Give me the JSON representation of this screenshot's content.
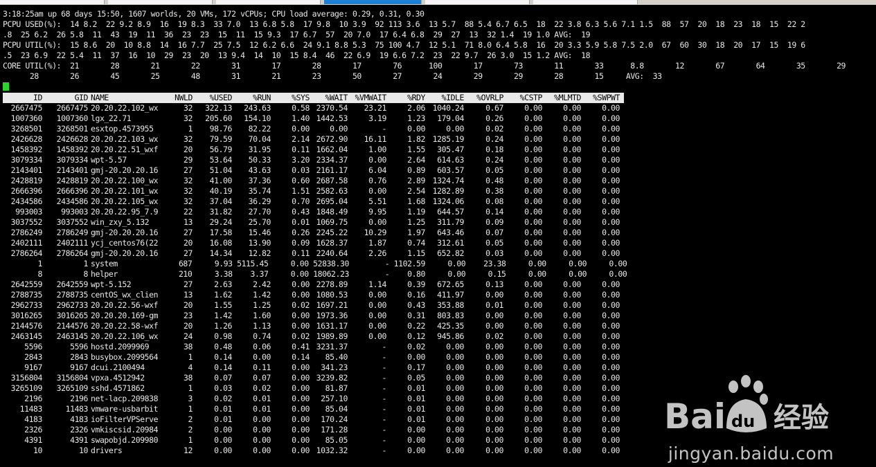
{
  "summary": {
    "l1": "3:18:25am up 68 days 15:50, 1607 worlds, 20 VMs, 172 vCPUs; CPU load average: 0.29, 0.31, 0.30",
    "l2": "PCPU USED(%):  14 8.2  22 9.2 8.9  16  19 8.3  33 7.0  13 6.8 5.8  17 9.8  10 3.9  92 113 3.6  13 5.7  88 5.4 6.7 6.5  18  22 3.8 6.3 5.6 7.1 1.5  88  57  20  18  23  18  15  22 2",
    "l3": ".8  25 6.2  26 5.8  11  43  19  11  36  23  23  15  11  15 9.3  17 6.7  57  20 7.0  17 6.4 6.8  29  27  13  32 1.4  19 1.0 AVG:  19",
    "l4": "PCPU UTIL(%):  15 8.6  20  10 8.8  14  16 7.7  25 7.5  12 6.2 6.6  24 9.1 8.8 5.3  75 100 4.7  12 5.1  71 8.0 6.4 5.8  16  20 3.3 5.9 5.8 7.5 2.0  67  60  30  18  20  17  15  19 6",
    "l5": ".5  23 6.9  22 5.4  11  37  16  10  29  23  20  13 9.4  14  10  15 8.4  46  22 6.9  19 6.6 7.2  23  22 9.7  26 3.0  15 1.2 AVG:  18",
    "l6": "CORE UTIL(%):  21       28       21       22       31       17       28       17       76      100       17       73       11       33      8.8       12       67       64       35       29       24",
    "l7": "      28       26       45       25       48       31       21       23       50       27       24       29       29       28       15     AVG:  33"
  },
  "columns": [
    "ID",
    "GID",
    "NAME",
    "NWLD",
    "%USED",
    "%RUN",
    "%SYS",
    "%WAIT",
    "%VMWAIT",
    "%RDY",
    "%IDLE",
    "%OVRLP",
    "%CSTP",
    "%MLMTD",
    "%SWPWT"
  ],
  "rows": [
    [
      "2667475",
      "2667475",
      "20.20.22.102_wx",
      "32",
      "322.13",
      "243.63",
      "0.58",
      "2370.54",
      "23.21",
      "2.06",
      "1040.24",
      "0.67",
      "0.00",
      "0.00",
      "0.00"
    ],
    [
      "1007360",
      "1007360",
      "lgx_22.71",
      "32",
      "205.60",
      "154.10",
      "1.40",
      "1442.53",
      "3.19",
      "1.23",
      "179.04",
      "0.26",
      "0.00",
      "0.00",
      "0.00"
    ],
    [
      "3268501",
      "3268501",
      "esxtop.4573955",
      "1",
      "98.76",
      "82.22",
      "0.00",
      "0.00",
      "-",
      "0.00",
      "0.00",
      "0.02",
      "0.00",
      "0.00",
      "0.00"
    ],
    [
      "2426628",
      "2426628",
      "20.20.22.103_wx",
      "32",
      "79.59",
      "70.04",
      "2.14",
      "2672.90",
      "16.11",
      "1.82",
      "1285.19",
      "0.24",
      "0.00",
      "0.00",
      "0.00"
    ],
    [
      "1458392",
      "1458392",
      "20.20.22.51_wxf",
      "20",
      "56.79",
      "31.95",
      "0.11",
      "1662.04",
      "1.00",
      "1.55",
      "305.47",
      "0.18",
      "0.00",
      "0.00",
      "0.00"
    ],
    [
      "3079334",
      "3079334",
      "wpt-5.57",
      "29",
      "53.64",
      "50.33",
      "3.20",
      "2334.37",
      "0.00",
      "2.64",
      "614.63",
      "0.24",
      "0.00",
      "0.00",
      "0.00"
    ],
    [
      "2143401",
      "2143401",
      "gmj-20.20.20.16",
      "27",
      "51.04",
      "43.63",
      "0.03",
      "2161.17",
      "6.04",
      "0.89",
      "603.57",
      "0.05",
      "0.00",
      "0.00",
      "0.00"
    ],
    [
      "2428819",
      "2428819",
      "20.20.22.100_wx",
      "32",
      "41.00",
      "37.36",
      "0.60",
      "2687.58",
      "0.76",
      "2.89",
      "1324.74",
      "0.48",
      "0.00",
      "0.00",
      "0.00"
    ],
    [
      "2666396",
      "2666396",
      "20.20.22.101_wx",
      "32",
      "40.19",
      "35.74",
      "1.51",
      "2582.63",
      "0.00",
      "2.54",
      "1282.89",
      "0.38",
      "0.00",
      "0.00",
      "0.00"
    ],
    [
      "2434586",
      "2434586",
      "20.20.22.105_wx",
      "32",
      "37.04",
      "36.29",
      "0.70",
      "2695.04",
      "5.51",
      "1.68",
      "1324.06",
      "0.08",
      "0.00",
      "0.00",
      "0.00"
    ],
    [
      "993003",
      "993003",
      "20.20.22.95_7.9",
      "22",
      "31.82",
      "27.70",
      "0.43",
      "1848.49",
      "9.95",
      "1.19",
      "644.57",
      "0.14",
      "0.00",
      "0.00",
      "0.00"
    ],
    [
      "3037552",
      "3037552",
      "win_zxy_5.132",
      "13",
      "29.24",
      "25.70",
      "0.01",
      "1069.75",
      "0.00",
      "1.25",
      "311.79",
      "0.09",
      "0.00",
      "0.00",
      "0.00"
    ],
    [
      "2786249",
      "2786249",
      "gmj-20.20.20.16",
      "27",
      "17.58",
      "15.46",
      "0.26",
      "2245.22",
      "10.29",
      "1.97",
      "643.46",
      "0.07",
      "0.00",
      "0.00",
      "0.00"
    ],
    [
      "2402111",
      "2402111",
      "ycj_centos76(22",
      "20",
      "16.08",
      "13.90",
      "0.09",
      "1628.37",
      "1.87",
      "0.74",
      "312.61",
      "0.05",
      "0.00",
      "0.00",
      "0.00"
    ],
    [
      "2786264",
      "2786264",
      "gmj-20.20.20.16",
      "27",
      "14.34",
      "12.82",
      "0.11",
      "2240.64",
      "2.26",
      "1.15",
      "652.82",
      "0.03",
      "0.00",
      "0.00",
      "0.00"
    ]
  ],
  "shifted_rows": [
    {
      "id": "1",
      "gid": "1",
      "name": "system",
      "rest": "  687     9.93 5115.45     0.00 52838.30        - 1102.59     0.00    23.38     0.00     0.00     0.00"
    },
    {
      "id": "8",
      "gid": "8",
      "name": "helper",
      "rest": "  210     3.38    3.37     0.00 18062.23        -    0.80     0.00     0.15     0.00     0.00     0.00"
    }
  ],
  "rows_after": [
    [
      "2642559",
      "2642559",
      "wpt-5.152",
      "27",
      "2.63",
      "2.42",
      "0.00",
      "2278.89",
      "1.14",
      "0.39",
      "672.65",
      "0.13",
      "0.00",
      "0.00",
      "0.00"
    ],
    [
      "2788735",
      "2788735",
      "centOS_wx_clien",
      "13",
      "1.62",
      "1.42",
      "0.00",
      "1080.53",
      "0.00",
      "0.16",
      "411.97",
      "0.00",
      "0.00",
      "0.00",
      "0.00"
    ],
    [
      "2962733",
      "2962733",
      "20.20.22.56-wxf",
      "20",
      "1.55",
      "1.25",
      "0.02",
      "1697.21",
      "0.00",
      "0.43",
      "353.88",
      "0.01",
      "0.00",
      "0.00",
      "0.00"
    ],
    [
      "3016265",
      "3016265",
      "20.20.20.169-gm",
      "23",
      "1.42",
      "1.60",
      "0.00",
      "1973.36",
      "0.00",
      "0.31",
      "803.83",
      "0.00",
      "0.00",
      "0.00",
      "0.00"
    ],
    [
      "2144576",
      "2144576",
      "20.20.22.58-wxf",
      "20",
      "1.26",
      "1.13",
      "0.00",
      "1631.17",
      "0.00",
      "0.22",
      "425.35",
      "0.00",
      "0.00",
      "0.00",
      "0.00"
    ],
    [
      "2463145",
      "2463145",
      "20.20.22.106_wx",
      "24",
      "0.98",
      "0.74",
      "0.02",
      "1989.89",
      "0.00",
      "0.12",
      "945.86",
      "0.02",
      "0.00",
      "0.00",
      "0.00"
    ],
    [
      "5596",
      "5596",
      "hostd.2099969",
      "38",
      "0.48",
      "0.06",
      "0.41",
      "3231.37",
      "-",
      "0.02",
      "0.00",
      "0.00",
      "0.00",
      "0.00",
      "0.00"
    ],
    [
      "2843",
      "2843",
      "busybox.2099564",
      "1",
      "0.14",
      "0.00",
      "0.14",
      "85.40",
      "-",
      "0.00",
      "0.00",
      "0.00",
      "0.00",
      "0.00",
      "0.00"
    ],
    [
      "9167",
      "9167",
      "dcui.2100494",
      "4",
      "0.14",
      "0.11",
      "0.00",
      "341.23",
      "-",
      "0.17",
      "0.00",
      "0.00",
      "0.00",
      "0.00",
      "0.00"
    ],
    [
      "3156804",
      "3156804",
      "vpxa.4512942",
      "38",
      "0.07",
      "0.07",
      "0.00",
      "3239.82",
      "-",
      "0.05",
      "0.00",
      "0.00",
      "0.00",
      "0.00",
      "0.00"
    ],
    [
      "3265109",
      "3265109",
      "sshd.4571862",
      "1",
      "0.03",
      "0.02",
      "0.00",
      "81.87",
      "-",
      "0.01",
      "0.00",
      "0.00",
      "0.00",
      "0.00",
      "0.00"
    ],
    [
      "2196",
      "2196",
      "net-lacp.209838",
      "3",
      "0.02",
      "0.01",
      "0.00",
      "257.10",
      "-",
      "0.01",
      "0.00",
      "0.00",
      "0.00",
      "0.00",
      "0.00"
    ],
    [
      "11483",
      "11483",
      "vmware-usbarbit",
      "1",
      "0.01",
      "0.01",
      "0.00",
      "85.04",
      "-",
      "0.01",
      "0.00",
      "0.00",
      "0.00",
      "0.00",
      "0.00"
    ],
    [
      "4183",
      "4183",
      "ioFilterVPServe",
      "2",
      "0.01",
      "0.00",
      "0.00",
      "170.24",
      "-",
      "0.01",
      "0.00",
      "0.00",
      "0.00",
      "0.00",
      "0.00"
    ],
    [
      "2326",
      "2326",
      "vmkiscsid.20984",
      "2",
      "0.00",
      "0.00",
      "0.00",
      "171.28",
      "-",
      "0.00",
      "0.00",
      "0.00",
      "0.00",
      "0.00",
      "0.00"
    ],
    [
      "4391",
      "4391",
      "swapobjd.209980",
      "1",
      "0.00",
      "0.00",
      "0.00",
      "85.05",
      "-",
      "0.00",
      "0.00",
      "0.00",
      "0.00",
      "0.00",
      "0.00"
    ],
    [
      "10",
      "10",
      "drivers",
      "12",
      "0.00",
      "0.00",
      "0.00",
      "1032.32",
      "-",
      "0.00",
      "0.00",
      "0.00",
      "0.00",
      "0.00",
      "0.00"
    ]
  ],
  "watermark": {
    "logo_left": "Bai",
    "logo_paw": "du",
    "logo_right": "经验",
    "url": "jingyan.baidu.com"
  },
  "colors": {
    "background": "#000000",
    "text": "#e8e8e8",
    "header_bg": "#e9e9e9",
    "cursor": "#2fd12f",
    "active_tab": "#1e7fd6"
  }
}
